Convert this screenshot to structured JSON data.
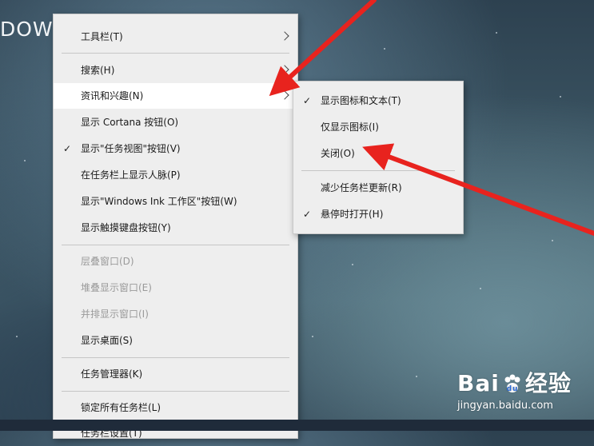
{
  "background": {
    "title_fragment": "DOW"
  },
  "main_menu": {
    "items": [
      {
        "label": "工具栏(T)"
      },
      {
        "label": "搜索(H)"
      },
      {
        "label": "资讯和兴趣(N)"
      },
      {
        "label": "显示 Cortana 按钮(O)"
      },
      {
        "label": "显示\"任务视图\"按钮(V)"
      },
      {
        "label": "在任务栏上显示人脉(P)"
      },
      {
        "label": "显示\"Windows Ink 工作区\"按钮(W)"
      },
      {
        "label": "显示触摸键盘按钮(Y)"
      },
      {
        "label": "层叠窗口(D)"
      },
      {
        "label": "堆叠显示窗口(E)"
      },
      {
        "label": "并排显示窗口(I)"
      },
      {
        "label": "显示桌面(S)"
      },
      {
        "label": "任务管理器(K)"
      },
      {
        "label": "锁定所有任务栏(L)"
      },
      {
        "label": "任务栏设置(T)"
      }
    ]
  },
  "sub_menu": {
    "items": [
      {
        "label": "显示图标和文本(T)"
      },
      {
        "label": "仅显示图标(I)"
      },
      {
        "label": "关闭(O)"
      },
      {
        "label": "减少任务栏更新(R)"
      },
      {
        "label": "悬停时打开(H)"
      }
    ]
  },
  "icons": {
    "check": "✓",
    "arrow_color": "#e8231e"
  },
  "watermark": {
    "logo_left": "Bai",
    "logo_right": "经验",
    "url": "jingyan.baidu.com"
  }
}
